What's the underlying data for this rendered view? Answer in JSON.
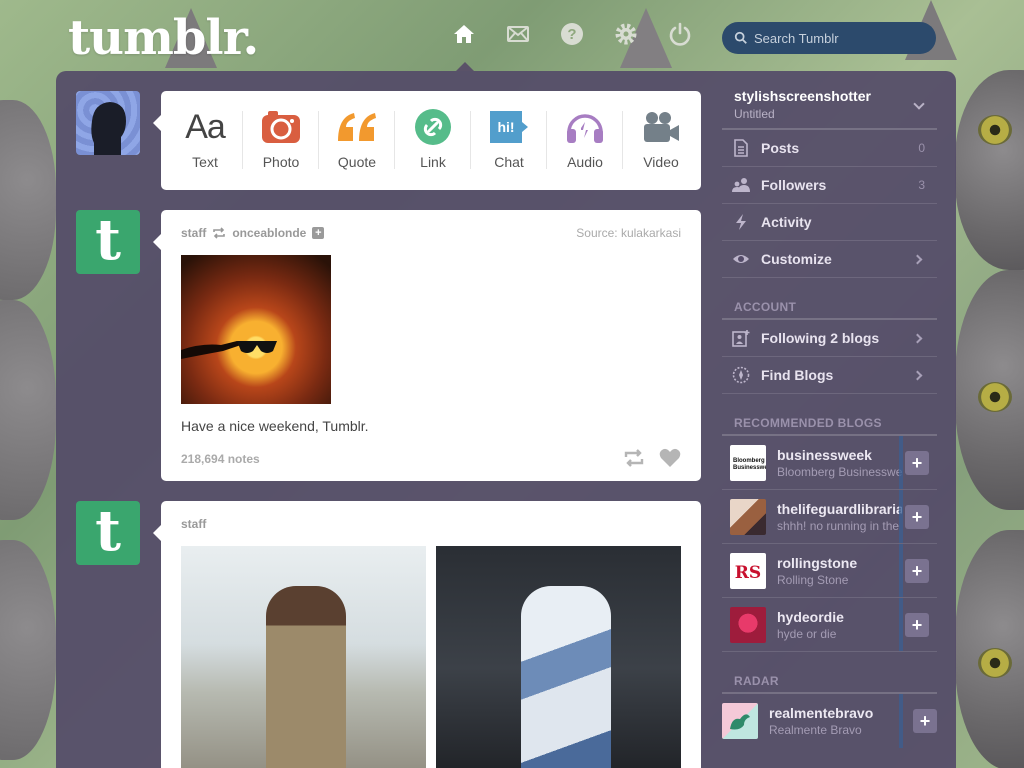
{
  "app": {
    "logo": "tumblr."
  },
  "header": {
    "nav": [
      "home-icon",
      "mail-icon",
      "help-icon",
      "gear-icon",
      "power-icon"
    ],
    "search_placeholder": "Search Tumblr"
  },
  "post_types": [
    {
      "label": "Text",
      "icon": "text-icon",
      "color": "#444444"
    },
    {
      "label": "Photo",
      "icon": "camera-icon",
      "color": "#d95e40"
    },
    {
      "label": "Quote",
      "icon": "quote-icon",
      "color": "#f2992e"
    },
    {
      "label": "Link",
      "icon": "link-icon",
      "color": "#56bc8a"
    },
    {
      "label": "Chat",
      "icon": "chat-icon",
      "color": "#529ecc"
    },
    {
      "label": "Audio",
      "icon": "headphones-icon",
      "color": "#a77dc2"
    },
    {
      "label": "Video",
      "icon": "video-icon",
      "color": "#748089"
    }
  ],
  "posts": [
    {
      "author": "staff",
      "reblog_from": "onceablonde",
      "source_label": "Source:",
      "source": "kulakarkasi",
      "caption": "Have a nice weekend, Tumblr.",
      "notes": "218,694 notes"
    },
    {
      "author": "staff"
    }
  ],
  "sidebar": {
    "blog_name": "stylishscreenshotter",
    "blog_sub": "Untitled",
    "items": [
      {
        "label": "Posts",
        "count": "0",
        "icon": "posts-icon"
      },
      {
        "label": "Followers",
        "count": "3",
        "icon": "followers-icon"
      },
      {
        "label": "Activity",
        "icon": "activity-icon"
      },
      {
        "label": "Customize",
        "icon": "eye-icon"
      }
    ],
    "account_title": "ACCOUNT",
    "account_items": [
      {
        "label": "Following 2 blogs",
        "icon": "following-icon"
      },
      {
        "label": "Find Blogs",
        "icon": "compass-icon"
      }
    ],
    "recommended_title": "RECOMMENDED BLOGS",
    "recommended": [
      {
        "name": "businessweek",
        "sub": "Bloomberg Businessweek"
      },
      {
        "name": "thelifeguardlibrarian",
        "sub": "shhh! no running in the library"
      },
      {
        "name": "rollingstone",
        "sub": "Rolling Stone"
      },
      {
        "name": "hydeordie",
        "sub": "hyde or die"
      }
    ],
    "radar_title": "RADAR",
    "radar": {
      "name": "realmentebravo",
      "sub": "Realmente Bravo"
    }
  },
  "colors": {
    "panel": "#544b68",
    "tumblr_green": "#3aa66e",
    "search_bg": "#2c4a6c"
  }
}
